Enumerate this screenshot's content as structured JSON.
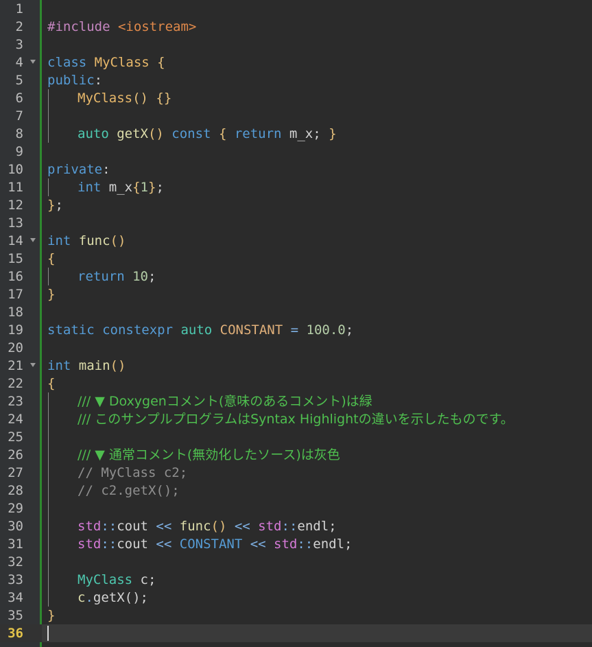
{
  "editor": {
    "current_line": 36,
    "fold_lines": [
      4,
      14,
      21
    ],
    "lines": [
      {
        "n": "1",
        "tokens": []
      },
      {
        "n": "2",
        "tokens": [
          {
            "c": "pp",
            "t": "#include "
          },
          {
            "c": "inc",
            "t": "<iostream>"
          }
        ]
      },
      {
        "n": "3",
        "tokens": []
      },
      {
        "n": "4",
        "tokens": [
          {
            "c": "kw",
            "t": "class "
          },
          {
            "c": "cls",
            "t": "MyClass "
          },
          {
            "c": "brace",
            "t": "{"
          }
        ]
      },
      {
        "n": "5",
        "tokens": [
          {
            "c": "kw",
            "t": "public"
          },
          {
            "c": "pl",
            "t": ":"
          }
        ]
      },
      {
        "n": "6",
        "ind": 1,
        "tokens": [
          {
            "c": "cls",
            "t": "MyClass"
          },
          {
            "c": "brace",
            "t": "() {}"
          }
        ]
      },
      {
        "n": "7",
        "ind": 1,
        "tokens": []
      },
      {
        "n": "8",
        "ind": 1,
        "tokens": [
          {
            "c": "kw2",
            "t": "auto "
          },
          {
            "c": "fn",
            "t": "getX"
          },
          {
            "c": "brace",
            "t": "() "
          },
          {
            "c": "kw",
            "t": "const "
          },
          {
            "c": "brace",
            "t": "{ "
          },
          {
            "c": "kw",
            "t": "return "
          },
          {
            "c": "pl",
            "t": "m_x; "
          },
          {
            "c": "brace",
            "t": "}"
          }
        ]
      },
      {
        "n": "9",
        "tokens": []
      },
      {
        "n": "10",
        "tokens": [
          {
            "c": "kw",
            "t": "private"
          },
          {
            "c": "pl",
            "t": ":"
          }
        ]
      },
      {
        "n": "11",
        "ind": 1,
        "tokens": [
          {
            "c": "kw",
            "t": "int "
          },
          {
            "c": "pl",
            "t": "m_x"
          },
          {
            "c": "brace",
            "t": "{"
          },
          {
            "c": "num",
            "t": "1"
          },
          {
            "c": "brace",
            "t": "}"
          },
          {
            "c": "pl",
            "t": ";"
          }
        ]
      },
      {
        "n": "12",
        "tokens": [
          {
            "c": "brace",
            "t": "}"
          },
          {
            "c": "pl",
            "t": ";"
          }
        ]
      },
      {
        "n": "13",
        "tokens": []
      },
      {
        "n": "14",
        "tokens": [
          {
            "c": "kw",
            "t": "int "
          },
          {
            "c": "fn",
            "t": "func"
          },
          {
            "c": "brace",
            "t": "()"
          }
        ]
      },
      {
        "n": "15",
        "tokens": [
          {
            "c": "brace",
            "t": "{"
          }
        ]
      },
      {
        "n": "16",
        "ind": 1,
        "tokens": [
          {
            "c": "kw",
            "t": "return "
          },
          {
            "c": "num",
            "t": "10"
          },
          {
            "c": "pl",
            "t": ";"
          }
        ]
      },
      {
        "n": "17",
        "tokens": [
          {
            "c": "brace",
            "t": "}"
          }
        ]
      },
      {
        "n": "18",
        "tokens": []
      },
      {
        "n": "19",
        "tokens": [
          {
            "c": "kw",
            "t": "static "
          },
          {
            "c": "kw",
            "t": "constexpr "
          },
          {
            "c": "kw2",
            "t": "auto "
          },
          {
            "c": "cpp-const",
            "t": "CONSTANT "
          },
          {
            "c": "op",
            "t": "= "
          },
          {
            "c": "num",
            "t": "100.0"
          },
          {
            "c": "pl",
            "t": ";"
          }
        ]
      },
      {
        "n": "20",
        "tokens": []
      },
      {
        "n": "21",
        "tokens": [
          {
            "c": "kw",
            "t": "int "
          },
          {
            "c": "fn",
            "t": "main"
          },
          {
            "c": "brace",
            "t": "()"
          }
        ]
      },
      {
        "n": "22",
        "tokens": [
          {
            "c": "brace",
            "t": "{"
          }
        ]
      },
      {
        "n": "23",
        "ind": 1,
        "tokens": [
          {
            "c": "dox",
            "t": "/// ▼ Doxygenコメント(意味のあるコメント)は緑"
          }
        ]
      },
      {
        "n": "24",
        "ind": 1,
        "tokens": [
          {
            "c": "dox",
            "t": "/// このサンプルプログラムはSyntax Highlightの違いを示したものです。"
          }
        ]
      },
      {
        "n": "25",
        "ind": 1,
        "tokens": []
      },
      {
        "n": "26",
        "ind": 1,
        "tokens": [
          {
            "c": "dox",
            "t": "/// ▼ 通常コメント(無効化したソース)は灰色"
          }
        ]
      },
      {
        "n": "27",
        "ind": 1,
        "tokens": [
          {
            "c": "cmt",
            "t": "// MyClass c2;"
          }
        ]
      },
      {
        "n": "28",
        "ind": 1,
        "tokens": [
          {
            "c": "cmt",
            "t": "// c2.getX();"
          }
        ]
      },
      {
        "n": "29",
        "ind": 1,
        "tokens": []
      },
      {
        "n": "30",
        "ind": 1,
        "tokens": [
          {
            "c": "ns",
            "t": "std"
          },
          {
            "c": "op",
            "t": "::"
          },
          {
            "c": "pl",
            "t": "cout "
          },
          {
            "c": "op",
            "t": "<< "
          },
          {
            "c": "fn",
            "t": "func"
          },
          {
            "c": "brace",
            "t": "() "
          },
          {
            "c": "op",
            "t": "<< "
          },
          {
            "c": "ns",
            "t": "std"
          },
          {
            "c": "op",
            "t": "::"
          },
          {
            "c": "pl",
            "t": "endl;"
          }
        ]
      },
      {
        "n": "31",
        "ind": 1,
        "tokens": [
          {
            "c": "ns",
            "t": "std"
          },
          {
            "c": "op",
            "t": "::"
          },
          {
            "c": "pl",
            "t": "cout "
          },
          {
            "c": "op",
            "t": "<< "
          },
          {
            "c": "kw",
            "t": "CONSTANT "
          },
          {
            "c": "op",
            "t": "<< "
          },
          {
            "c": "ns",
            "t": "std"
          },
          {
            "c": "op",
            "t": "::"
          },
          {
            "c": "pl",
            "t": "endl;"
          }
        ]
      },
      {
        "n": "32",
        "ind": 1,
        "tokens": []
      },
      {
        "n": "33",
        "ind": 1,
        "tokens": [
          {
            "c": "type",
            "t": "MyClass "
          },
          {
            "c": "pl",
            "t": "c;"
          }
        ]
      },
      {
        "n": "34",
        "ind": 1,
        "tokens": [
          {
            "c": "fn",
            "t": "c"
          },
          {
            "c": "op",
            "t": "."
          },
          {
            "c": "pl",
            "t": "getX();"
          }
        ]
      },
      {
        "n": "35",
        "tokens": [
          {
            "c": "brace",
            "t": "}"
          }
        ]
      },
      {
        "n": "36",
        "tokens": [],
        "caret": true
      }
    ]
  },
  "colors": {
    "background": "#2b2b2b",
    "gutter": "#313335",
    "change_bar": "#2e8a2e",
    "current_line_number": "#e3c34a",
    "doxygen_comment": "#4fbf4f",
    "normal_comment": "#8f8f8f"
  }
}
